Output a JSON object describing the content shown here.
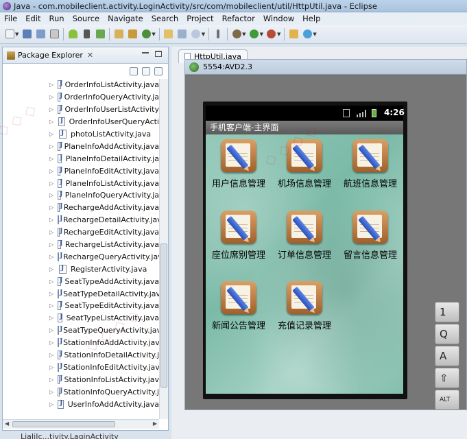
{
  "window": {
    "title": "Java - com.mobileclient.activity.LoginActivity/src/com/mobileclient/util/HttpUtil.java - Eclipse"
  },
  "menubar": [
    "File",
    "Edit",
    "Run",
    "Source",
    "Navigate",
    "Search",
    "Project",
    "Refactor",
    "Window",
    "Help"
  ],
  "package_explorer": {
    "title": "Package Explorer",
    "close": "✕",
    "files": [
      "OrderInfoListActivity.java",
      "OrderInfoQueryActivity.ja",
      "OrderInfoUserListActivity",
      "OrderInfoUserQueryActi",
      "photoListActivity.java",
      "PlaneInfoAddActivity.java",
      "PlaneInfoDetailActivity.ja",
      "PlaneInfoEditActivity.java",
      "PlaneInfoListActivity.java",
      "PlaneInfoQueryActivity.ja",
      "RechargeAddActivity.java",
      "RechargeDetailActivity.jav",
      "RechargeEditActivity.java",
      "RechargeListActivity.java",
      "RechargeQueryActivity.jav",
      "RegisterActivity.java",
      "SeatTypeAddActivity.java",
      "SeatTypeDetailActivity.jav",
      "SeatTypeEditActivity.java",
      "SeatTypeListActivity.java",
      "SeatTypeQueryActivity.jav",
      "StationInfoAddActivity.java",
      "StationInfoDetailActivity.j",
      "StationInfoEditActivity.jav",
      "StationInfoListActivity.jav",
      "StationInfoQueryActivity.j",
      "UserInfoAddActivity.java"
    ]
  },
  "status_fragment": "LiaIiIc...tivity.LaginActivity",
  "editor": {
    "tab_label": "HttpUtil.java"
  },
  "emulator": {
    "window_title": "5554:AVD2.3",
    "clock": "4:26",
    "app_title": "手机客户端-主界面",
    "grid": [
      "用户信息管理",
      "机场信息管理",
      "航班信息管理",
      "座位席别管理",
      "订单信息管理",
      "留言信息管理",
      "新闻公告管理",
      "充值记录管理"
    ],
    "keys": [
      "1",
      "Q",
      "A",
      "⇧",
      "ALT"
    ]
  },
  "colors": {
    "accent": "#a9c3de",
    "emulator_bg": "#777777",
    "app_bg": "#8fc6b6"
  }
}
